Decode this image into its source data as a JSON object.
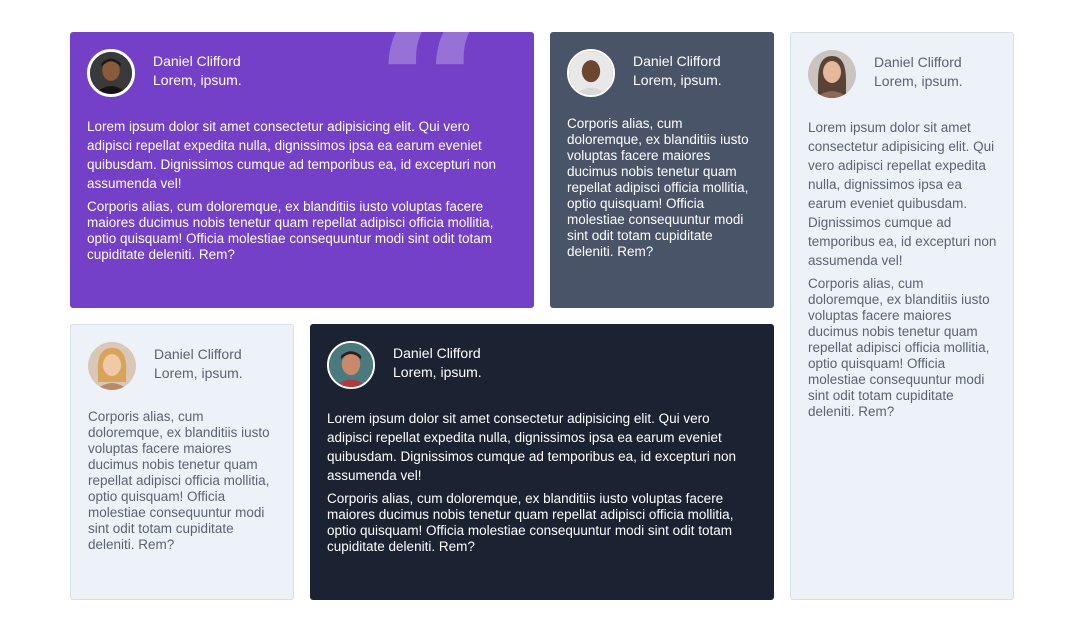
{
  "testimonials": [
    {
      "name": "Daniel Clifford",
      "role": "Lorem, ipsum.",
      "quote_mark": "“",
      "paragraphs": [
        "Lorem ipsum dolor sit amet consectetur adipisicing elit. Qui vero adipisci repellat expedita nulla, dignissimos ipsa ea earum eveniet quibusdam. Dignissimos cumque ad temporibus ea, id excepturi non assumenda vel!",
        "Corporis alias, cum doloremque, ex blanditiis iusto voluptas facere maiores ducimus nobis tenetur quam repellat adipisci officia mollitia, optio quisquam! Officia molestiae consequuntur modi sint odit totam cupiditate deleniti. Rem?"
      ],
      "background": "#7440c8"
    },
    {
      "name": "Daniel Clifford",
      "role": "Lorem, ipsum.",
      "paragraphs": [
        "Corporis alias, cum doloremque, ex blanditiis iusto voluptas facere maiores ducimus nobis tenetur quam repellat adipisci officia mollitia, optio quisquam! Officia molestiae consequuntur modi sint odit totam cupiditate deleniti. Rem?"
      ],
      "background": "#4a5468"
    },
    {
      "name": "Daniel Clifford",
      "role": "Lorem, ipsum.",
      "paragraphs": [
        "Lorem ipsum dolor sit amet consectetur adipisicing elit. Qui vero adipisci repellat expedita nulla, dignissimos ipsa ea earum eveniet quibusdam. Dignissimos cumque ad temporibus ea, id excepturi non assumenda vel!",
        "Corporis alias, cum doloremque, ex blanditiis iusto voluptas facere maiores ducimus nobis tenetur quam repellat adipisci officia mollitia, optio quisquam! Officia molestiae consequuntur modi sint odit totam cupiditate deleniti. Rem?"
      ],
      "background": "#edf2f8"
    },
    {
      "name": "Daniel Clifford",
      "role": "Lorem, ipsum.",
      "paragraphs": [
        "Corporis alias, cum doloremque, ex blanditiis iusto voluptas facere maiores ducimus nobis tenetur quam repellat adipisci officia mollitia, optio quisquam! Officia molestiae consequuntur modi sint odit totam cupiditate deleniti. Rem?"
      ],
      "background": "#edf2f8"
    },
    {
      "name": "Daniel Clifford",
      "role": "Lorem, ipsum.",
      "paragraphs": [
        "Lorem ipsum dolor sit amet consectetur adipisicing elit. Qui vero adipisci repellat expedita nulla, dignissimos ipsa ea earum eveniet quibusdam. Dignissimos cumque ad temporibus ea, id excepturi non assumenda vel!",
        "Corporis alias, cum doloremque, ex blanditiis iusto voluptas facere maiores ducimus nobis tenetur quam repellat adipisci officia mollitia, optio quisquam! Officia molestiae consequuntur modi sint odit totam cupiditate deleniti. Rem?"
      ],
      "background": "#1b2232"
    }
  ]
}
